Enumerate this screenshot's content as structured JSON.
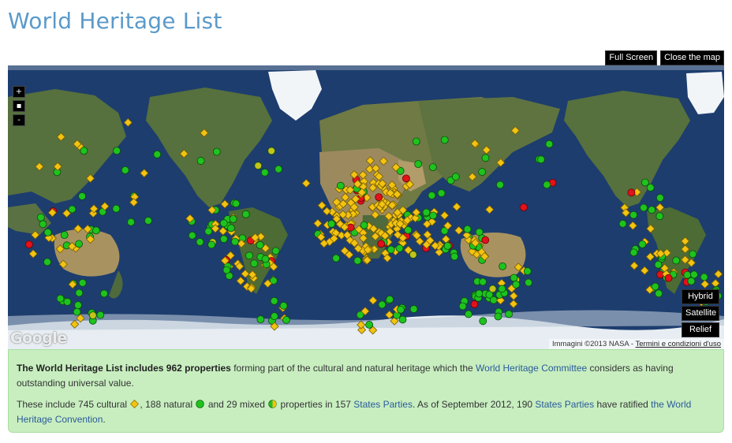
{
  "page": {
    "title": "World Heritage List"
  },
  "controls": {
    "full_screen": "Full Screen",
    "close_map": "Close the map",
    "zoom_in": "+",
    "zoom_reset": "▪",
    "zoom_out": "-",
    "map_types": [
      "Hybrid",
      "Satellite",
      "Relief"
    ]
  },
  "map": {
    "logo": "Google",
    "attribution_text": "Immagini ©2013 NASA - ",
    "terms_link": "Termini e condizioni d'uso",
    "colors": {
      "ocean": "#1d3d6e",
      "land": "#4f6a3c",
      "desert": "#9c8a5e",
      "ice": "#eef2f5",
      "cultural": "#f2c311",
      "natural": "#1ec31e",
      "mixed": "#c2c419",
      "endangered": "#e2111a"
    }
  },
  "info": {
    "line1_bold": "The World Heritage List includes 962 properties",
    "line1_text": " forming part of the cultural and natural heritage which the ",
    "line1_link": "World Heritage Committee",
    "line1_end": " considers as having outstanding universal value.",
    "line2_a": "These include 745 cultural ",
    "line2_b": ", 188 natural ",
    "line2_c": " and 29 mixed ",
    "line2_d": " properties in 157 ",
    "link_states1": "States Parties",
    "line2_e": ". As of September 2012, 190 ",
    "link_states2": "States Parties",
    "line2_f": " have ratified ",
    "link_convention": "the World Heritage Convention",
    "line2_g": "."
  }
}
